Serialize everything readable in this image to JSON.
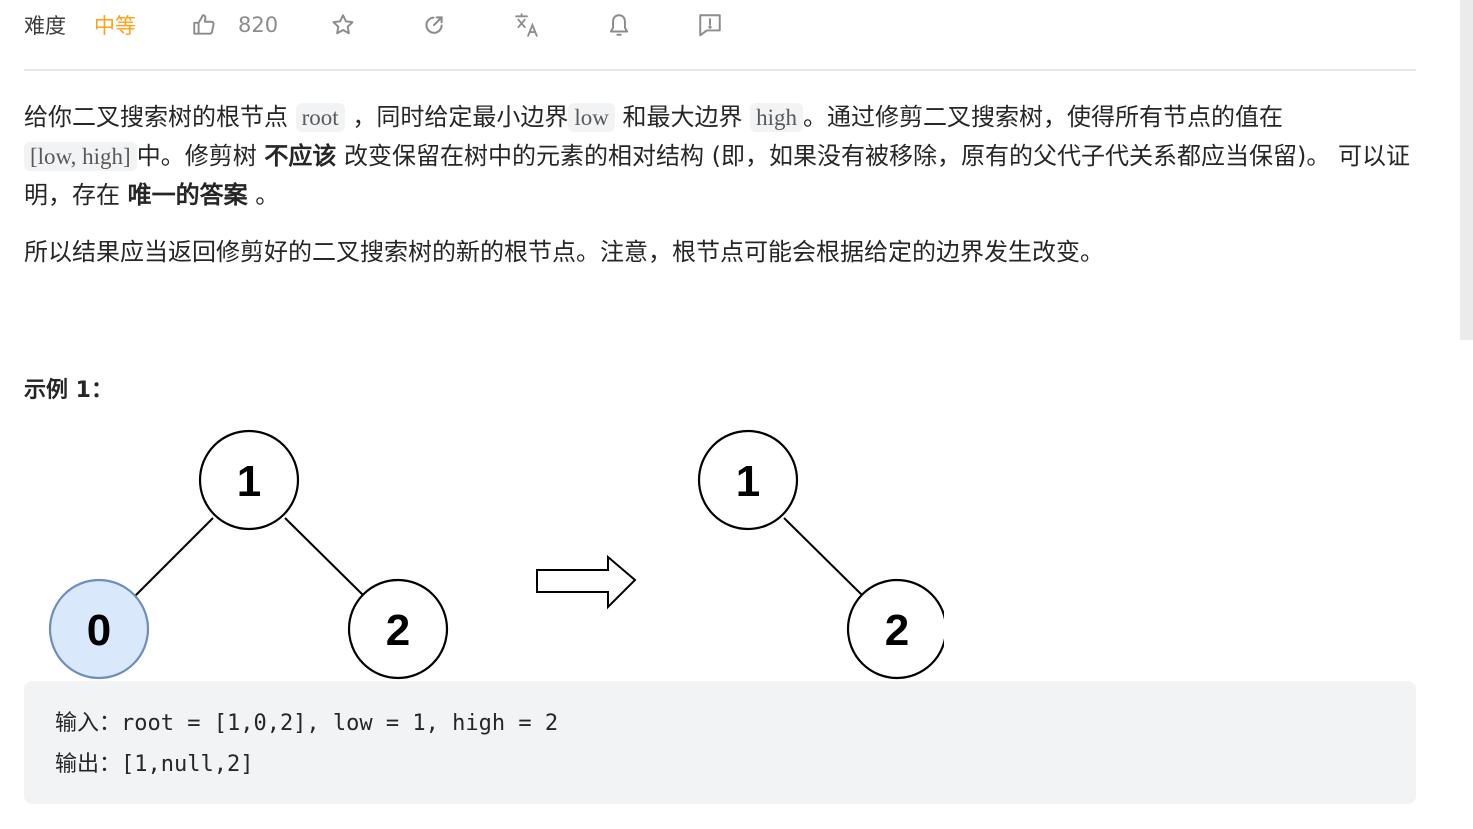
{
  "toolbar": {
    "difficulty_label": "难度",
    "difficulty_value": "中等",
    "difficulty_color": "#ffa116",
    "like_count": "820",
    "icons": [
      "thumbs-up-icon",
      "star-icon",
      "share-icon",
      "translate-icon",
      "bell-icon",
      "feedback-icon"
    ]
  },
  "description": {
    "p1": {
      "t1": "给你二叉搜索树的根节点 ",
      "c1": "root",
      "t2": " ，同时给定最小边界",
      "c2": "low",
      "t3": " 和最大边界 ",
      "c3": "high",
      "t4": "。通过修剪二叉搜索树，使得所有节点的值在",
      "c4": "[low, high]",
      "t5": "中。修剪树 ",
      "b1": "不应该",
      "t6": " 改变保留在树中的元素的相对结构 (即，如果没有被移除，原有的父代子代关系都应当保留)。 可以证明，存在 ",
      "b2": "唯一的答案",
      "t7": " 。"
    },
    "p2": "所以结果应当返回修剪好的二叉搜索树的新的根节点。注意，根节点可能会根据给定的边界发生改变。"
  },
  "example": {
    "title": "示例 1：",
    "diagram": {
      "before": {
        "root": "1",
        "left": "0",
        "right": "2",
        "removed_node": "0"
      },
      "after": {
        "root": "1",
        "right": "2"
      },
      "highlight_color": "#dae8fc",
      "highlight_stroke": "#6c8ebf"
    },
    "input_line": "输入：root = [1,0,2], low = 1, high = 2",
    "output_line": "输出：[1,null,2]"
  }
}
